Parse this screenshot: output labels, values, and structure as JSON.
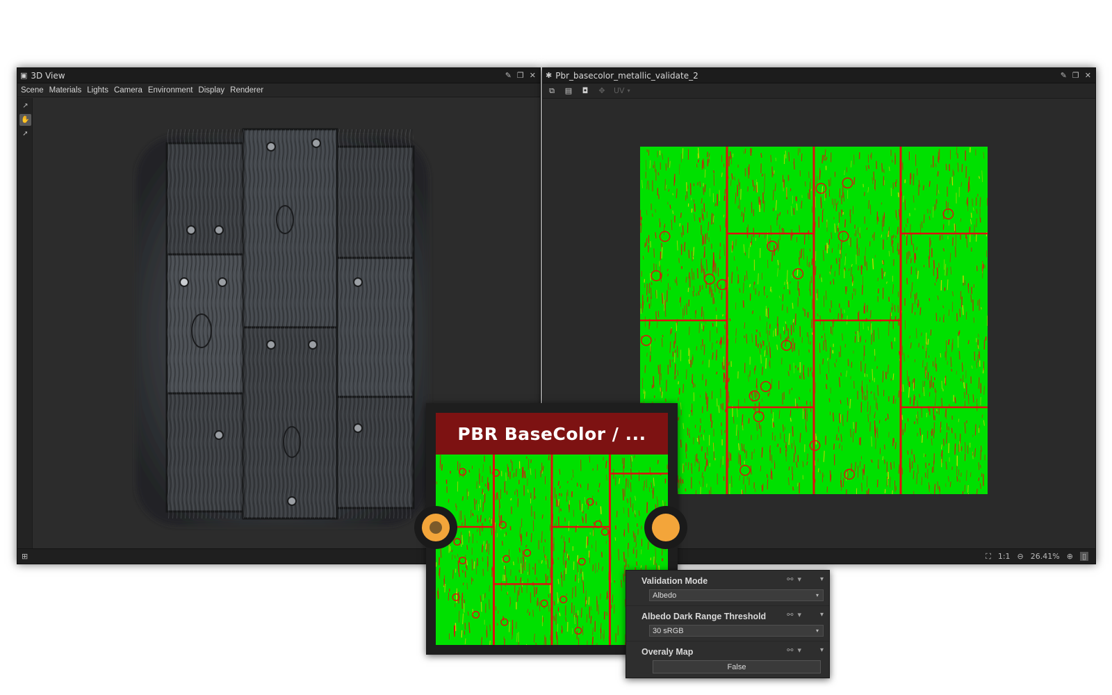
{
  "left_window": {
    "title": "3D View",
    "menu": [
      "Scene",
      "Materials",
      "Lights",
      "Camera",
      "Environment",
      "Display",
      "Renderer"
    ]
  },
  "right_window": {
    "title": "Pbr_basecolor_metallic_validate_2",
    "toolbar_dropdown": "UV",
    "zoom_ratio": "1:1",
    "zoom_percent": "26.41%"
  },
  "node": {
    "title": "PBR BaseColor / ..."
  },
  "params": [
    {
      "label": "Validation Mode",
      "kind": "select",
      "value": "Albedo"
    },
    {
      "label": "Albedo Dark Range Threshold",
      "kind": "select",
      "value": "30 sRGB"
    },
    {
      "label": "Overaly Map",
      "kind": "button",
      "value": "False"
    }
  ],
  "colors": {
    "valid": "#00e000",
    "invalid": "#e01010",
    "warn": "#d4d400",
    "node_header": "#7d1212",
    "port": "#f3a53a"
  }
}
